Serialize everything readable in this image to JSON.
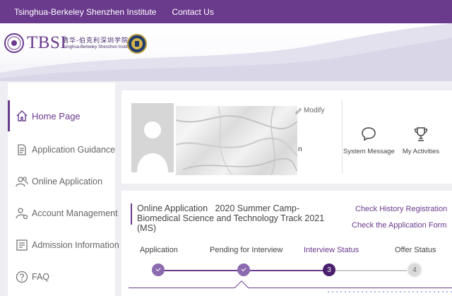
{
  "topnav": {
    "institute": "Tsinghua-Berkeley Shenzhen Institute",
    "contact": "Contact Us"
  },
  "logo": {
    "abbr": "TBSI",
    "cn_name": "清华-伯克利深圳学院",
    "en_name": "Tsinghua-Berkeley Shenzhen Institute"
  },
  "sidebar": {
    "items": [
      {
        "label": "Home Page",
        "icon": "home-icon",
        "active": true
      },
      {
        "label": "Application Guidance",
        "icon": "document-icon"
      },
      {
        "label": "Online Application",
        "icon": "users-icon"
      },
      {
        "label": "Account Management",
        "icon": "user-gear-icon"
      },
      {
        "label": "Admission Information",
        "icon": "news-icon"
      },
      {
        "label": "FAQ",
        "icon": "question-icon"
      }
    ]
  },
  "profile": {
    "modify": "Modify",
    "name_tail": "n",
    "system_message": "System Message",
    "my_activities": "My Activities"
  },
  "application": {
    "title_prefix": "Online Application",
    "title": "2020 Summer Camp-Biomedical Science and Technology Track 2021 (MS)",
    "check_history": "Check History Registration",
    "check_form": "Check the Application Form",
    "steps": [
      {
        "label": "Application",
        "status": "done",
        "num": ""
      },
      {
        "label": "Pending for Interview",
        "status": "done",
        "num": ""
      },
      {
        "label": "Interview Status",
        "status": "current",
        "num": "3"
      },
      {
        "label": "Offer Status",
        "status": "todo",
        "num": "4"
      }
    ]
  },
  "colors": {
    "brand": "#6a3a8d",
    "current_step": "#4a1f6e",
    "done_step": "#8c6ab0"
  }
}
